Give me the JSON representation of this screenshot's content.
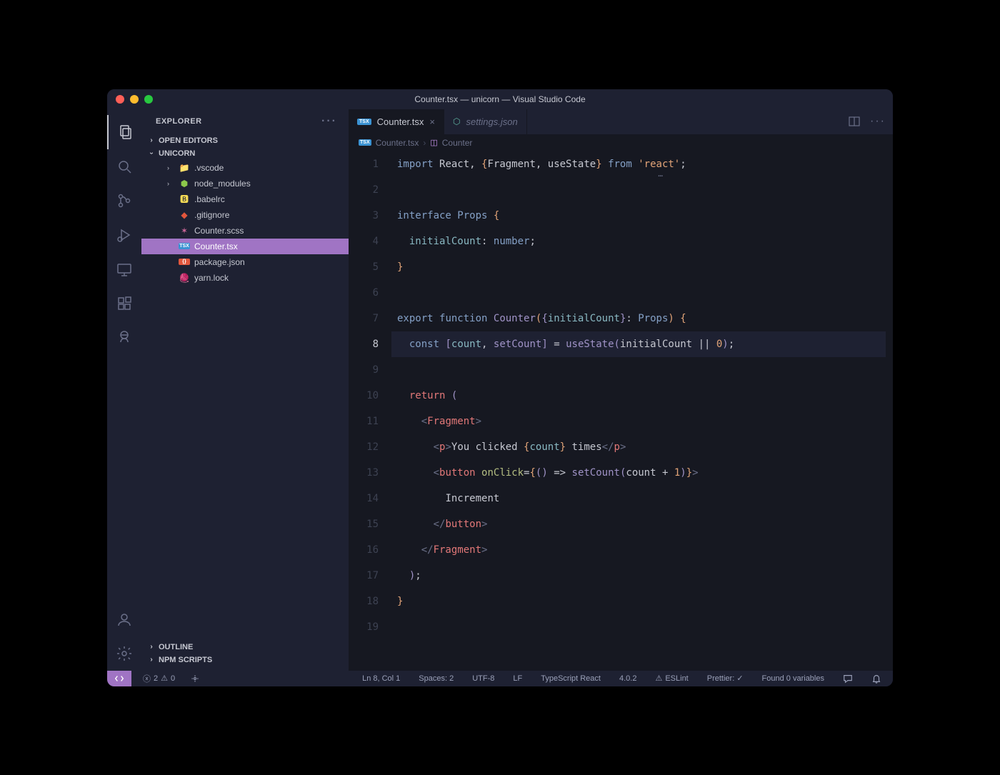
{
  "window": {
    "title": "Counter.tsx — unicorn — Visual Studio Code"
  },
  "activity_bar": {
    "items": [
      "files-icon",
      "search-icon",
      "source-control-icon",
      "debug-icon",
      "remote-explorer-icon",
      "extensions-icon",
      "live-share-icon"
    ],
    "bottom": [
      "account-icon",
      "gear-icon"
    ]
  },
  "sidebar": {
    "header": "EXPLORER",
    "sections": {
      "open_editors": "OPEN EDITORS",
      "project": "UNICORN",
      "outline": "OUTLINE",
      "npm": "NPM SCRIPTS"
    },
    "tree": [
      {
        "name": ".vscode",
        "kind": "folder",
        "expandable": true
      },
      {
        "name": "node_modules",
        "kind": "node",
        "expandable": true
      },
      {
        "name": ".babelrc",
        "kind": "babel"
      },
      {
        "name": ".gitignore",
        "kind": "git"
      },
      {
        "name": "Counter.scss",
        "kind": "scss"
      },
      {
        "name": "Counter.tsx",
        "kind": "tsx",
        "selected": true
      },
      {
        "name": "package.json",
        "kind": "json"
      },
      {
        "name": "yarn.lock",
        "kind": "yarn"
      }
    ]
  },
  "tabs": [
    {
      "label": "Counter.tsx",
      "icon": "tsx",
      "active": true,
      "closable": true
    },
    {
      "label": "settings.json",
      "icon": "json-green",
      "active": false,
      "italic": true
    }
  ],
  "breadcrumb": {
    "file": "Counter.tsx",
    "symbol": "Counter"
  },
  "editor": {
    "active_line": 8,
    "line_count": 19,
    "lines_html": [
      "<span class='kw'>import</span> <span class='ident'>React</span><span class='punc'>, </span><span class='brace-y'>{</span><span class='ident'>Fragment</span><span class='punc'>, </span><span class='ident'>useState</span><span class='brace-y'>}</span> <span class='kw'>from</span> <span class='str'>'react'</span><span class='punc'>;</span>",
      "",
      "<span class='kw'>interface</span> <span class='type'>Props</span> <span class='brace-y'>{</span>",
      "  <span class='prop'>initialCount</span><span class='punc'>:</span> <span class='type'>number</span><span class='punc'>;</span>",
      "<span class='brace-y'>}</span>",
      "",
      "<span class='kw'>export</span> <span class='kw'>function</span> <span class='fn'>Counter</span><span class='brace-y'>(</span><span class='brace-p'>{</span><span class='prop'>initialCount</span><span class='brace-p'>}</span><span class='punc'>:</span> <span class='type'>Props</span><span class='brace-y'>)</span> <span class='brace-y'>{</span>",
      "  <span class='kw'>const</span> <span class='brace-p'>[</span><span class='prop'>count</span><span class='punc'>, </span><span class='fn'>setCount</span><span class='brace-p'>]</span> <span class='punc'>=</span> <span class='fn'>useState</span><span class='brace-p'>(</span><span class='ident'>initialCount</span> <span class='punc'>||</span> <span class='num'>0</span><span class='brace-p'>)</span><span class='punc'>;</span>",
      "",
      "  <span class='kw2'>return</span> <span class='brace-p'>(</span>",
      "    <span class='angle'>&lt;</span><span class='tag'>Fragment</span><span class='angle'>&gt;</span>",
      "      <span class='angle'>&lt;</span><span class='tag'>p</span><span class='angle'>&gt;</span><span class='ident'>You clicked </span><span class='brace-y'>{</span><span class='prop'>count</span><span class='brace-y'>}</span><span class='ident'> times</span><span class='angle'>&lt;/</span><span class='tag'>p</span><span class='angle'>&gt;</span>",
      "      <span class='angle'>&lt;</span><span class='tag'>button</span> <span class='attr'>onClick</span><span class='punc'>=</span><span class='brace-y'>{</span><span class='brace-p'>()</span> <span class='punc'>=&gt;</span> <span class='fn'>setCount</span><span class='brace-p'>(</span><span class='ident'>count</span> <span class='punc'>+</span> <span class='num'>1</span><span class='brace-p'>)</span><span class='brace-y'>}</span><span class='angle'>&gt;</span>",
      "        <span class='ident'>Increment</span>",
      "      <span class='angle'>&lt;/</span><span class='tag'>button</span><span class='angle'>&gt;</span>",
      "    <span class='angle'>&lt;/</span><span class='tag'>Fragment</span><span class='angle'>&gt;</span>",
      "  <span class='brace-p'>)</span><span class='punc'>;</span>",
      "<span class='brace-y'>}</span>",
      ""
    ]
  },
  "statusbar": {
    "errors": "2",
    "warnings": "0",
    "ln_col": "Ln 8, Col 1",
    "spaces": "Spaces: 2",
    "encoding": "UTF-8",
    "eol": "LF",
    "lang": "TypeScript React",
    "version": "4.0.2",
    "eslint": "ESLint",
    "prettier": "Prettier: ✓",
    "variables": "Found 0 variables"
  }
}
